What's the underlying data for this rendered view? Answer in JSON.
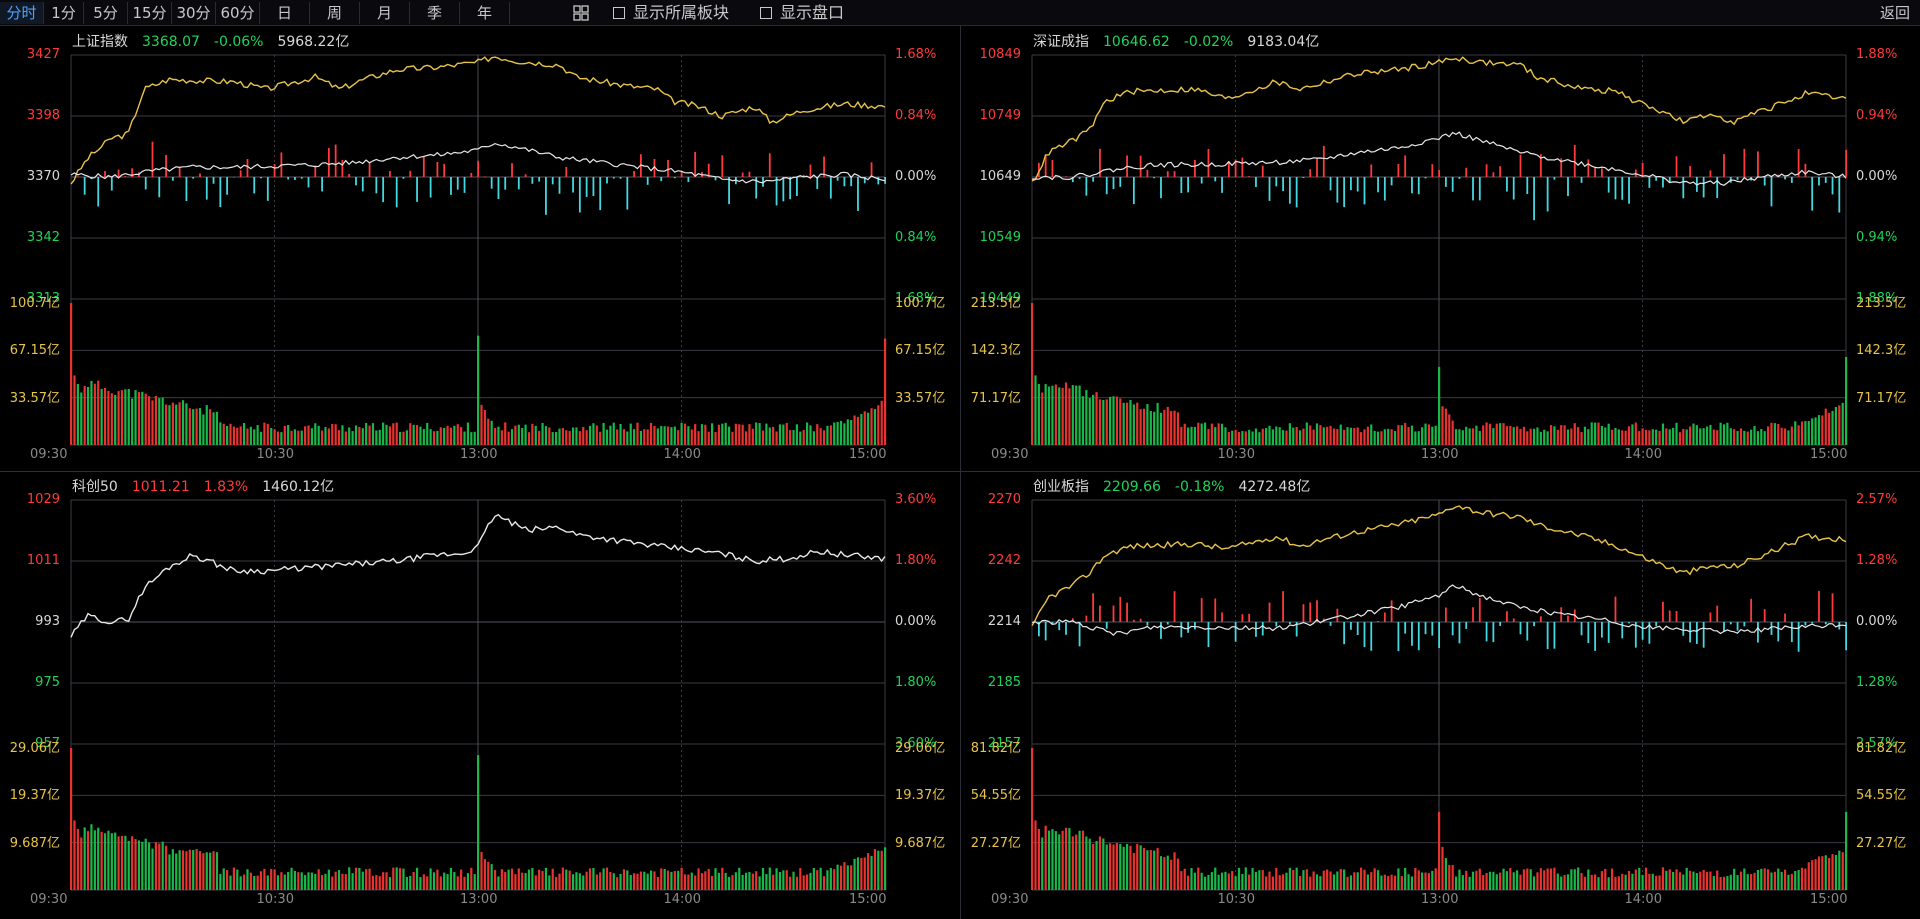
{
  "toolbar": {
    "periods": [
      {
        "label": "分时",
        "active": true
      },
      {
        "label": "1分",
        "active": false
      },
      {
        "label": "5分",
        "active": false
      },
      {
        "label": "15分",
        "active": false
      },
      {
        "label": "30分",
        "active": false
      },
      {
        "label": "60分",
        "active": false
      },
      {
        "label": "日",
        "active": false
      },
      {
        "label": "周",
        "active": false
      },
      {
        "label": "月",
        "active": false
      },
      {
        "label": "季",
        "active": false
      },
      {
        "label": "年",
        "active": false
      }
    ],
    "show_sector_label": "显示所属板块",
    "show_orderbook_label": "显示盘口",
    "back_label": "返回"
  },
  "colors": {
    "up": "#ff3a3a",
    "down": "#1fd35a",
    "price": "#e8c34a",
    "avg": "#e8e8e8",
    "vol_up": "#e8332f",
    "vol_down": "#18b84a",
    "neg_bar": "#44d7e0"
  },
  "time_labels": [
    "09:30",
    "10:30",
    "13:00",
    "14:00",
    "15:00"
  ],
  "panels": [
    {
      "name": "上证指数",
      "price": "3368.07",
      "change_pct": "-0.06%",
      "change_dir": "down",
      "turnover": "5968.22亿",
      "price_ticks": [
        "3427",
        "3398",
        "3370",
        "3342",
        "3313"
      ],
      "pct_ticks": [
        "1.68%",
        "0.84%",
        "0.00%",
        "0.84%",
        "1.68%"
      ],
      "vol_ticks": [
        "100.7亿",
        "67.15亿",
        "33.57亿"
      ],
      "has_white_line": true,
      "has_yellow_line": true,
      "has_flow_bars": true
    },
    {
      "name": "深证成指",
      "price": "10646.62",
      "change_pct": "-0.02%",
      "change_dir": "down",
      "turnover": "9183.04亿",
      "price_ticks": [
        "10849",
        "10749",
        "10649",
        "10549",
        "10449"
      ],
      "pct_ticks": [
        "1.88%",
        "0.94%",
        "0.00%",
        "0.94%",
        "1.88%"
      ],
      "vol_ticks": [
        "213.5亿",
        "142.3亿",
        "71.17亿"
      ],
      "has_white_line": true,
      "has_yellow_line": true,
      "has_flow_bars": true
    },
    {
      "name": "科创50",
      "price": "1011.21",
      "change_pct": "1.83%",
      "change_dir": "up",
      "turnover": "1460.12亿",
      "price_ticks": [
        "1029",
        "1011",
        "993",
        "975",
        "957"
      ],
      "pct_ticks": [
        "3.60%",
        "1.80%",
        "0.00%",
        "1.80%",
        "3.60%"
      ],
      "vol_ticks": [
        "29.06亿",
        "19.37亿",
        "9.687亿"
      ],
      "has_white_line": true,
      "has_yellow_line": false,
      "has_flow_bars": false
    },
    {
      "name": "创业板指",
      "price": "2209.66",
      "change_pct": "-0.18%",
      "change_dir": "down",
      "turnover": "4272.48亿",
      "price_ticks": [
        "2270",
        "2242",
        "2214",
        "2185",
        "2157"
      ],
      "pct_ticks": [
        "2.57%",
        "1.28%",
        "0.00%",
        "1.28%",
        "2.57%"
      ],
      "vol_ticks": [
        "81.82亿",
        "54.55亿",
        "27.27亿"
      ],
      "has_white_line": true,
      "has_yellow_line": true,
      "has_flow_bars": true
    }
  ]
}
